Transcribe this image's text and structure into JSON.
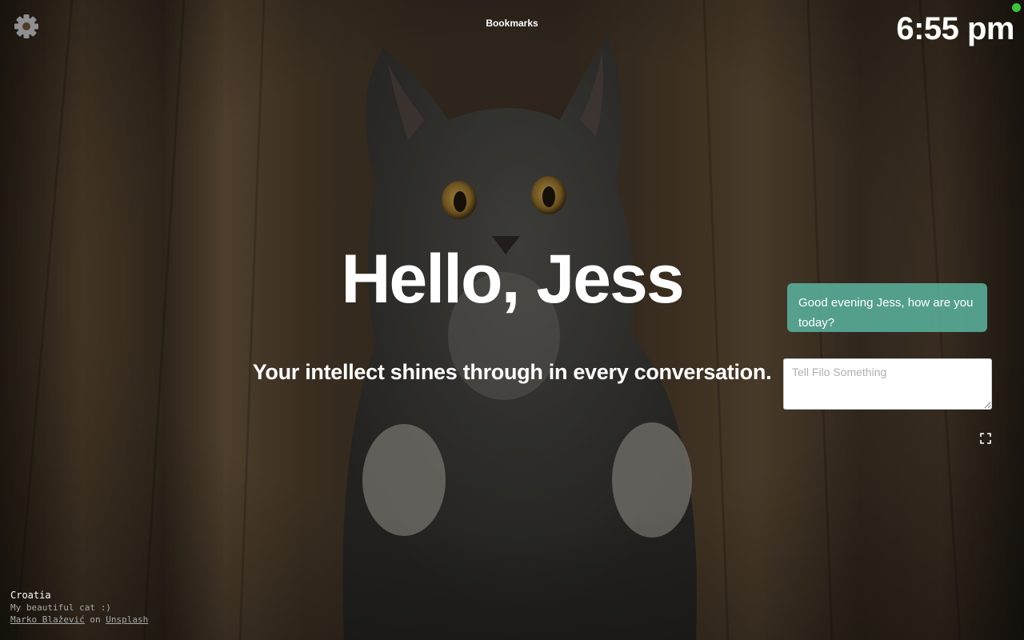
{
  "header": {
    "bookmarks_label": "Bookmarks",
    "clock_text": "6:55 pm",
    "settings_icon": "gear-icon",
    "status_color": "#3cc43a"
  },
  "main": {
    "greeting": "Hello, Jess",
    "compliment": "Your intellect shines through in every conversation."
  },
  "chat": {
    "bot_message": "Good evening Jess, how are you today?",
    "input_placeholder": "Tell Filo Something",
    "input_value": "",
    "bubble_color": "#5ab29e",
    "fullscreen_icon": "fullscreen-icon"
  },
  "credits": {
    "location": "Croatia",
    "caption": "My beautiful cat :)",
    "photographer": "Marko Blažević",
    "on_text": "on",
    "source": "Unsplash"
  }
}
